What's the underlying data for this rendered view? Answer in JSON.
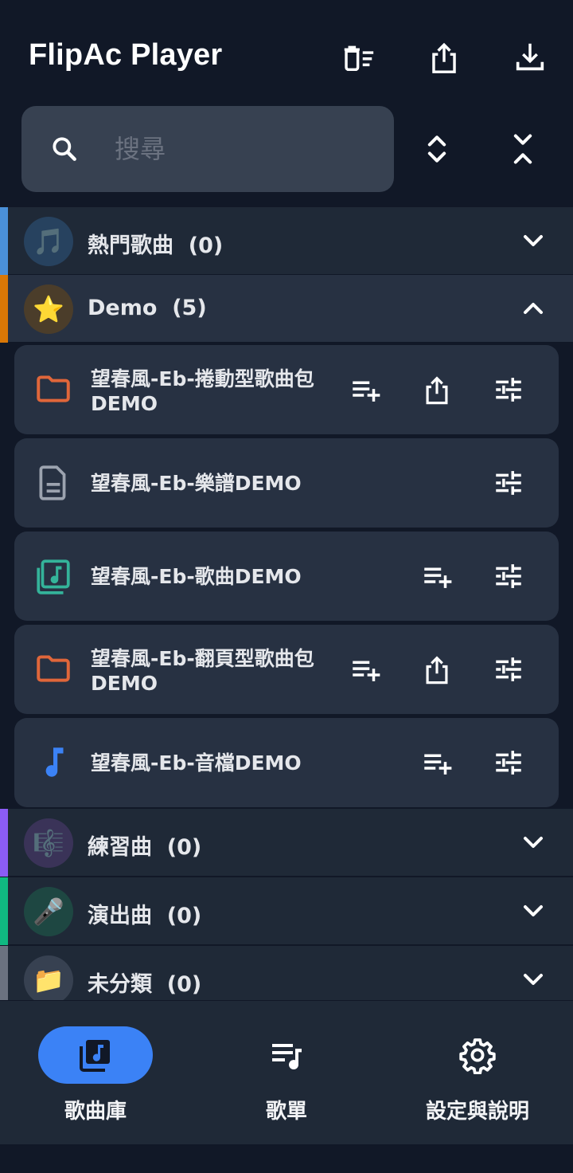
{
  "app": {
    "title": "FlipAc Player"
  },
  "search": {
    "placeholder": "搜尋",
    "value": ""
  },
  "categories": [
    {
      "label": "熱門歌曲  (0)",
      "emoji": "🎵",
      "accent": "#4a90d9",
      "avatar_bg": "#27425f",
      "expanded": false
    },
    {
      "label": "Demo  (5)",
      "emoji": "⭐",
      "accent": "#d97706",
      "avatar_bg": "#4b3d2a",
      "expanded": true
    },
    {
      "label": "練習曲  (0)",
      "emoji": "🎼",
      "accent": "#8b5cf6",
      "avatar_bg": "#3a3358",
      "expanded": false
    },
    {
      "label": "演出曲  (0)",
      "emoji": "🎤",
      "accent": "#10b981",
      "avatar_bg": "#1e4742",
      "expanded": false
    },
    {
      "label": "未分類  (0)",
      "emoji": "📁",
      "accent": "#6b7280",
      "avatar_bg": "#374151",
      "expanded": false
    }
  ],
  "songs": [
    {
      "title": "望春風-Eb-捲動型歌曲包DEMO",
      "icon": "folder-icon",
      "icon_color": "#e0663a"
    },
    {
      "title": "望春風-Eb-樂譜DEMO",
      "icon": "document-icon",
      "icon_color": "#9ca3af"
    },
    {
      "title": "望春風-Eb-歌曲DEMO",
      "icon": "music-library-icon",
      "icon_color": "#34b39a"
    },
    {
      "title": "望春風-Eb-翻頁型歌曲包DEMO",
      "icon": "folder-icon",
      "icon_color": "#e0663a"
    },
    {
      "title": "望春風-Eb-音檔DEMO",
      "icon": "music-note-icon",
      "icon_color": "#3b82f6"
    }
  ],
  "nav": [
    {
      "label": "歌曲庫",
      "icon": "library-music-icon",
      "active": true
    },
    {
      "label": "歌單",
      "icon": "playlist-music-icon",
      "active": false
    },
    {
      "label": "設定與說明",
      "icon": "gear-icon",
      "active": false
    }
  ],
  "colors": {
    "accent": "#3b82f6",
    "background": "#111827",
    "surface": "#1f2937"
  }
}
